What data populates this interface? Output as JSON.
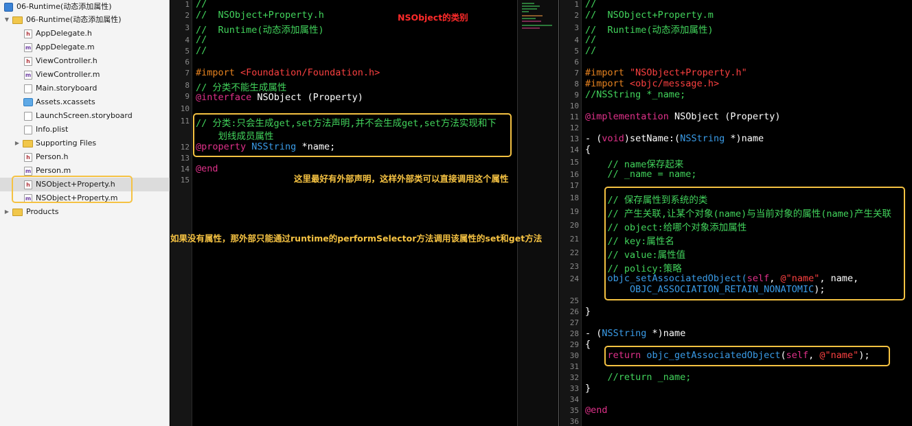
{
  "navigator": {
    "items": [
      {
        "label": "06-Runtime(动态添加属性)",
        "kind": "project",
        "expanded": true
      },
      {
        "label": "06-Runtime(动态添加属性)",
        "kind": "folder",
        "expanded": true
      },
      {
        "label": "AppDelegate.h",
        "kind": "h"
      },
      {
        "label": "AppDelegate.m",
        "kind": "m"
      },
      {
        "label": "ViewController.h",
        "kind": "h"
      },
      {
        "label": "ViewController.m",
        "kind": "m"
      },
      {
        "label": "Main.storyboard",
        "kind": "storyboard"
      },
      {
        "label": "Assets.xcassets",
        "kind": "assets"
      },
      {
        "label": "LaunchScreen.storyboard",
        "kind": "storyboard"
      },
      {
        "label": "Info.plist",
        "kind": "plist"
      },
      {
        "label": "Supporting Files",
        "kind": "folder",
        "expanded": false
      },
      {
        "label": "Person.h",
        "kind": "h"
      },
      {
        "label": "Person.m",
        "kind": "m"
      },
      {
        "label": "NSObject+Property.h",
        "kind": "h",
        "selected": true
      },
      {
        "label": "NSObject+Property.m",
        "kind": "m"
      },
      {
        "label": "Products",
        "kind": "folder",
        "expanded": false
      }
    ],
    "file_glyphs": {
      "h": "h",
      "m": "m"
    }
  },
  "left_editor": {
    "line_numbers": [
      "1",
      "2",
      "3",
      "4",
      "5",
      "6",
      "7",
      "8",
      "9",
      "10",
      "11",
      "12",
      "13",
      "14",
      "15"
    ],
    "code": {
      "l1": "//",
      "l2": "//  NSObject+Property.h",
      "l3": "//  Runtime(动态添加属性)",
      "l4": "//",
      "l5": "//",
      "l7a": "#import ",
      "l7b": "<Foundation/Foundation.h>",
      "l8": "// 分类不能生成属性",
      "l9a": "@interface",
      "l9b": " NSObject (Property)",
      "l11a": "// 分类:只会生成get,set方法声明,并不会生成get,set方法实现和下",
      "l11b": "    划线成员属性",
      "l12a": "@property",
      "l12b": " NSString",
      "l12c": " *name;",
      "l14": "@end"
    },
    "annotations": {
      "category": "NSObject的类别",
      "external_decl": "这里最好有外部声明，这样外部类可以直接调用这个属性",
      "no_property": "如果没有属性，那外部只能通过runtime的performSelector方法调用该属性的set和get方法"
    }
  },
  "right_editor": {
    "line_numbers": [
      "1",
      "2",
      "3",
      "4",
      "5",
      "6",
      "7",
      "8",
      "9",
      "10",
      "11",
      "12",
      "13",
      "14",
      "15",
      "16",
      "17",
      "18",
      "19",
      "20",
      "21",
      "22",
      "23",
      "24",
      "25",
      "26",
      "27",
      "28",
      "29",
      "30",
      "31",
      "32",
      "33",
      "34",
      "35",
      "36"
    ],
    "code": {
      "l1": "//",
      "l2": "//  NSObject+Property.m",
      "l3": "//  Runtime(动态添加属性)",
      "l4": "//",
      "l5": "//",
      "l7a": "#import ",
      "l7b": "\"NSObject+Property.h\"",
      "l8a": "#import ",
      "l8b": "<objc/message.h>",
      "l9": "//NSString *_name;",
      "l11a": "@implementation",
      "l11b": " NSObject (Property)",
      "l13a": "- (",
      "l13b": "void",
      "l13c": ")setName:(",
      "l13d": "NSString",
      "l13e": " *)name",
      "l14": "{",
      "l15": "    // name保存起来",
      "l16": "    // _name = name;",
      "l18": "    // 保存属性到系统的类",
      "l19": "    // 产生关联,让某个对象(name)与当前对象的属性(name)产生关联",
      "l20": "    // object:给哪个对象添加属性",
      "l21": "    // key:属性名",
      "l22": "    // value:属性值",
      "l23": "    // policy:策略",
      "l24a": "    objc_setAssociatedObject(",
      "l24b": "self",
      "l24c": ", ",
      "l24d": "@\"name\"",
      "l24e": ", name,",
      "l24f": "        OBJC_ASSOCIATION_RETAIN_NONATOMIC",
      "l24g": ");",
      "l26": "}",
      "l28a": "- (",
      "l28b": "NSString",
      "l28c": " *)name",
      "l29": "{",
      "l30a": "    return",
      "l30b": " objc_getAssociatedObject",
      "l30c": "(",
      "l30d": "self",
      "l30e": ", ",
      "l30f": "@\"name\"",
      "l30g": ");",
      "l32": "    //return _name;",
      "l33": "}",
      "l35": "@end"
    }
  }
}
